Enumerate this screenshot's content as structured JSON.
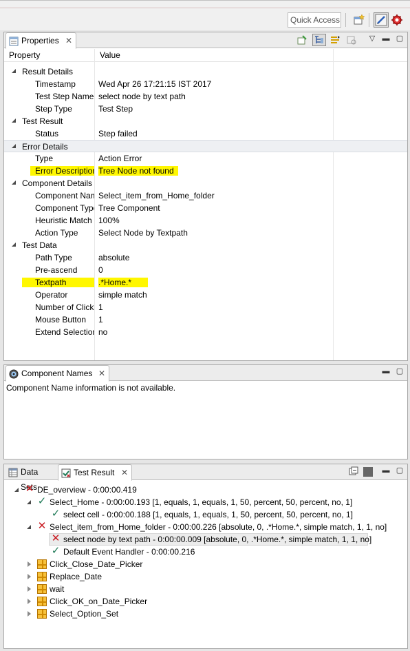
{
  "toolbar": {
    "quick_access": "Quick Access"
  },
  "properties": {
    "tab_label": "Properties",
    "col_property": "Property",
    "col_value": "Value",
    "rows": [
      {
        "type": "group",
        "name": "Result Details"
      },
      {
        "type": "item",
        "name": "Timestamp",
        "value": "Wed Apr 26 17:21:15 IST 2017"
      },
      {
        "type": "item",
        "name": "Test Step Name",
        "value": "select node by text path"
      },
      {
        "type": "item",
        "name": "Step Type",
        "value": "Test Step"
      },
      {
        "type": "group",
        "name": "Test Result"
      },
      {
        "type": "item",
        "name": "Status",
        "value": "Step failed"
      },
      {
        "type": "group",
        "name": "Error Details"
      },
      {
        "type": "item",
        "name": "Type",
        "value": "Action Error"
      },
      {
        "type": "item",
        "name": "Error Description",
        "value": "Tree Node not found"
      },
      {
        "type": "group",
        "name": "Component Details"
      },
      {
        "type": "item",
        "name": "Component Name",
        "value": "Select_item_from_Home_folder"
      },
      {
        "type": "item",
        "name": "Component Type",
        "value": "Tree Component"
      },
      {
        "type": "item",
        "name": "Heuristic Match",
        "value": "100%"
      },
      {
        "type": "item",
        "name": "Action Type",
        "value": "Select Node by Textpath"
      },
      {
        "type": "group",
        "name": "Test Data"
      },
      {
        "type": "item",
        "name": "Path Type",
        "value": "absolute"
      },
      {
        "type": "item",
        "name": "Pre-ascend",
        "value": "0"
      },
      {
        "type": "item",
        "name": "Textpath",
        "value": ".*Home.*"
      },
      {
        "type": "item",
        "name": "Operator",
        "value": "simple match"
      },
      {
        "type": "item",
        "name": "Number of Clicks",
        "value": "1"
      },
      {
        "type": "item",
        "name": "Mouse Button",
        "value": "1"
      },
      {
        "type": "item",
        "name": "Extend Selection",
        "value": "no"
      }
    ]
  },
  "component_names": {
    "tab_label": "Component Names",
    "message": "Component Name information is not available."
  },
  "bottom": {
    "tab_data_sets": "Data Sets",
    "tab_test_result": "Test Result",
    "tree": [
      {
        "level": 0,
        "twisty": "open",
        "icon": "error-x-icon",
        "label": "DE_overview - 0:00:00.419"
      },
      {
        "level": 1,
        "twisty": "open",
        "icon": "success-check-icon",
        "label": "Select_Home - 0:00:00.193 [1, equals, 1, equals, 1, 50, percent, 50, percent, no, 1]"
      },
      {
        "level": 2,
        "twisty": "none",
        "icon": "success-check-icon",
        "label": "select cell - 0:00:00.188 [1, equals, 1, equals, 1, 50, percent, 50, percent, no, 1]"
      },
      {
        "level": 1,
        "twisty": "open",
        "icon": "error-x-icon",
        "label": "Select_item_from_Home_folder - 0:00:00.226 [absolute, 0, .*Home.*, simple match, 1, 1, no]"
      },
      {
        "level": 2,
        "twisty": "none",
        "icon": "error-x-icon",
        "label": "select node by text path - 0:00:00.009 [absolute, 0, .*Home.*, simple match, 1, 1, no]",
        "selected": true
      },
      {
        "level": 2,
        "twisty": "none",
        "icon": "success-check-icon",
        "label": "Default Event Handler - 0:00:00.216"
      },
      {
        "level": 1,
        "twisty": "closed",
        "icon": "test-case-grid-icon",
        "label": "Click_Close_Date_Picker"
      },
      {
        "level": 1,
        "twisty": "closed",
        "icon": "test-case-grid-icon",
        "label": "Replace_Date"
      },
      {
        "level": 1,
        "twisty": "closed",
        "icon": "test-case-grid-icon",
        "label": "wait"
      },
      {
        "level": 1,
        "twisty": "closed",
        "icon": "test-case-grid-icon",
        "label": "Click_OK_on_Date_Picker"
      },
      {
        "level": 1,
        "twisty": "closed",
        "icon": "test-case-grid-icon",
        "label": "Select_Option_Set"
      }
    ]
  },
  "colors": {
    "highlight": "#fff700",
    "error": "#c8171e",
    "success": "#1f7a57"
  }
}
